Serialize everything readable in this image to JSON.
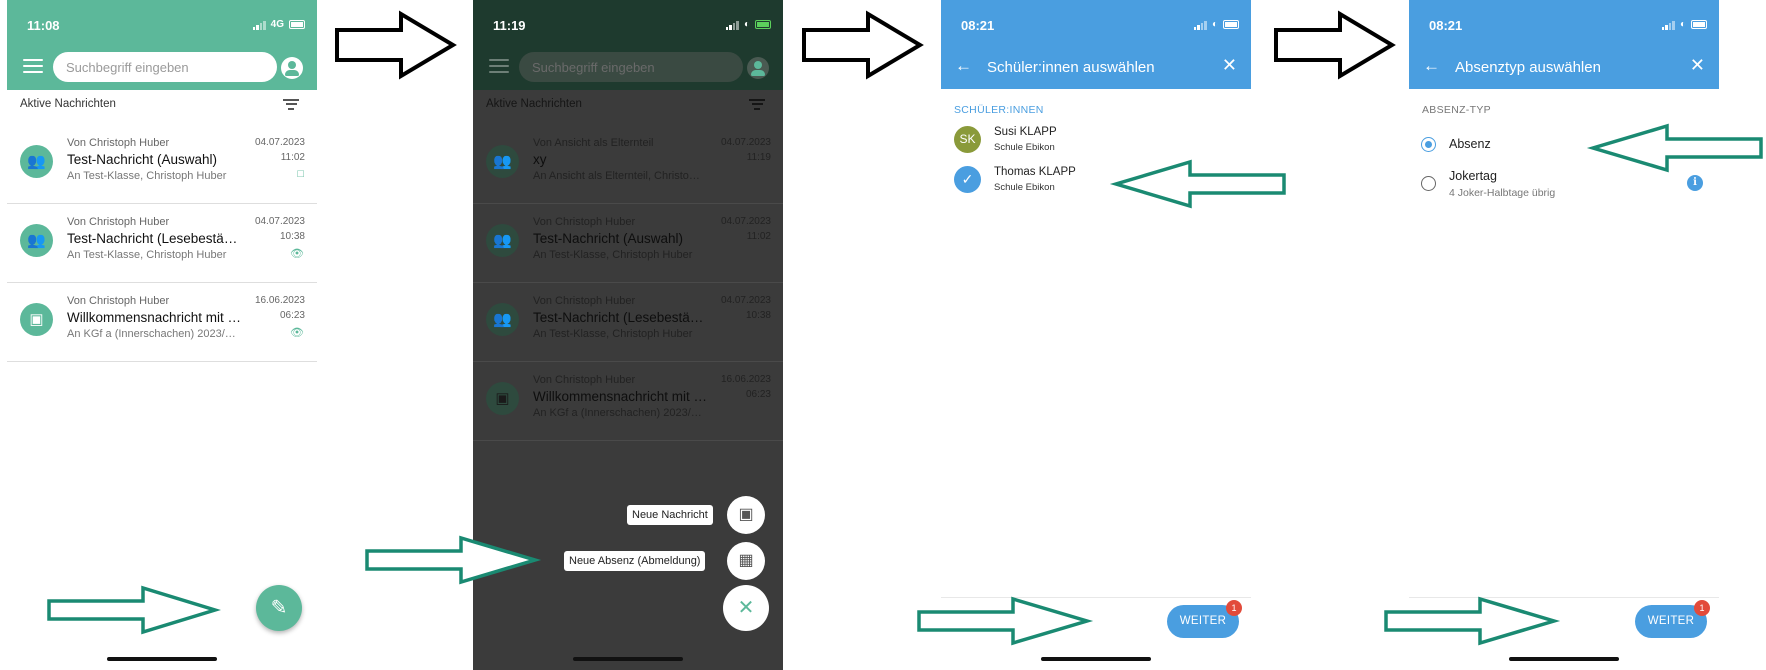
{
  "colors": {
    "green": "#5cb89a",
    "dark_bg": "#3b3b3b",
    "dark_header": "#1e3a2e",
    "blue": "#4a9ee0",
    "badge_red": "#e24b3b",
    "olive_avatar": "#8a9a3a",
    "arrow_teal": "#1a8a72",
    "arrow_black": "#000000"
  },
  "screen1": {
    "status": {
      "time": "11:08",
      "network": "4G"
    },
    "search_placeholder": "Suchbegriff eingeben",
    "section_title": "Aktive Nachrichten",
    "messages": [
      {
        "from": "Von Christoph Huber",
        "title": "Test-Nachricht (Auswahl)",
        "sub": "An Test-Klasse, Christoph Huber",
        "date": "04.07.2023",
        "time": "11:02",
        "status_icon": "reply-icon",
        "avatar_icon": "group-icon"
      },
      {
        "from": "Von Christoph Huber",
        "title": "Test-Nachricht (Lesebestä…",
        "sub": "An Test-Klasse, Christoph Huber",
        "date": "04.07.2023",
        "time": "10:38",
        "status_icon": "eye-icon",
        "avatar_icon": "group-icon"
      },
      {
        "from": "Von Christoph Huber",
        "title": "Willkommensnachricht mit …",
        "sub": "An KGf a (Innerschachen) 2023/…",
        "date": "16.06.2023",
        "time": "06:23",
        "status_icon": "eye-icon",
        "avatar_icon": "chat-icon"
      }
    ],
    "fab_icon": "pencil-icon"
  },
  "screen2": {
    "status": {
      "time": "11:19"
    },
    "search_placeholder": "Suchbegriff eingeben",
    "section_title": "Aktive Nachrichten",
    "messages": [
      {
        "from": "Von Ansicht als Elternteil",
        "title": "xy",
        "sub": "An Ansicht als Elternteil, Christo…",
        "date": "04.07.2023",
        "time": "11:19"
      },
      {
        "from": "Von Christoph Huber",
        "title": "Test-Nachricht (Auswahl)",
        "sub": "An Test-Klasse, Christoph Huber",
        "date": "04.07.2023",
        "time": "11:02"
      },
      {
        "from": "Von Christoph Huber",
        "title": "Test-Nachricht (Lesebestä…",
        "sub": "An Test-Klasse, Christoph Huber",
        "date": "04.07.2023",
        "time": "10:38"
      },
      {
        "from": "Von Christoph Huber",
        "title": "Willkommensnachricht mit …",
        "sub": "An KGf a (Innerschachen) 2023/…",
        "date": "16.06.2023",
        "time": "06:23"
      }
    ],
    "speed_dial": {
      "new_message": "Neue Nachricht",
      "new_absence": "Neue Absenz (Abmeldung)",
      "close_icon": "close-icon"
    }
  },
  "screen3": {
    "status": {
      "time": "08:21"
    },
    "title": "Schüler:innen auswählen",
    "section": "SCHÜLER:INNEN",
    "students": [
      {
        "initials": "SK",
        "name": "Susi KLAPP",
        "school": "Schule Ebikon",
        "selected": false
      },
      {
        "initials": "",
        "name": "Thomas KLAPP",
        "school": "Schule Ebikon",
        "selected": true
      }
    ],
    "button": "WEITER",
    "badge": "1"
  },
  "screen4": {
    "status": {
      "time": "08:21"
    },
    "title": "Absenztyp auswählen",
    "section": "ABSENZ-TYP",
    "options": [
      {
        "label": "Absenz",
        "sub": "",
        "selected": true
      },
      {
        "label": "Jokertag",
        "sub": "4 Joker-Halbtage übrig",
        "selected": false
      }
    ],
    "info_icon": "info-icon",
    "button": "WEITER",
    "badge": "1"
  }
}
